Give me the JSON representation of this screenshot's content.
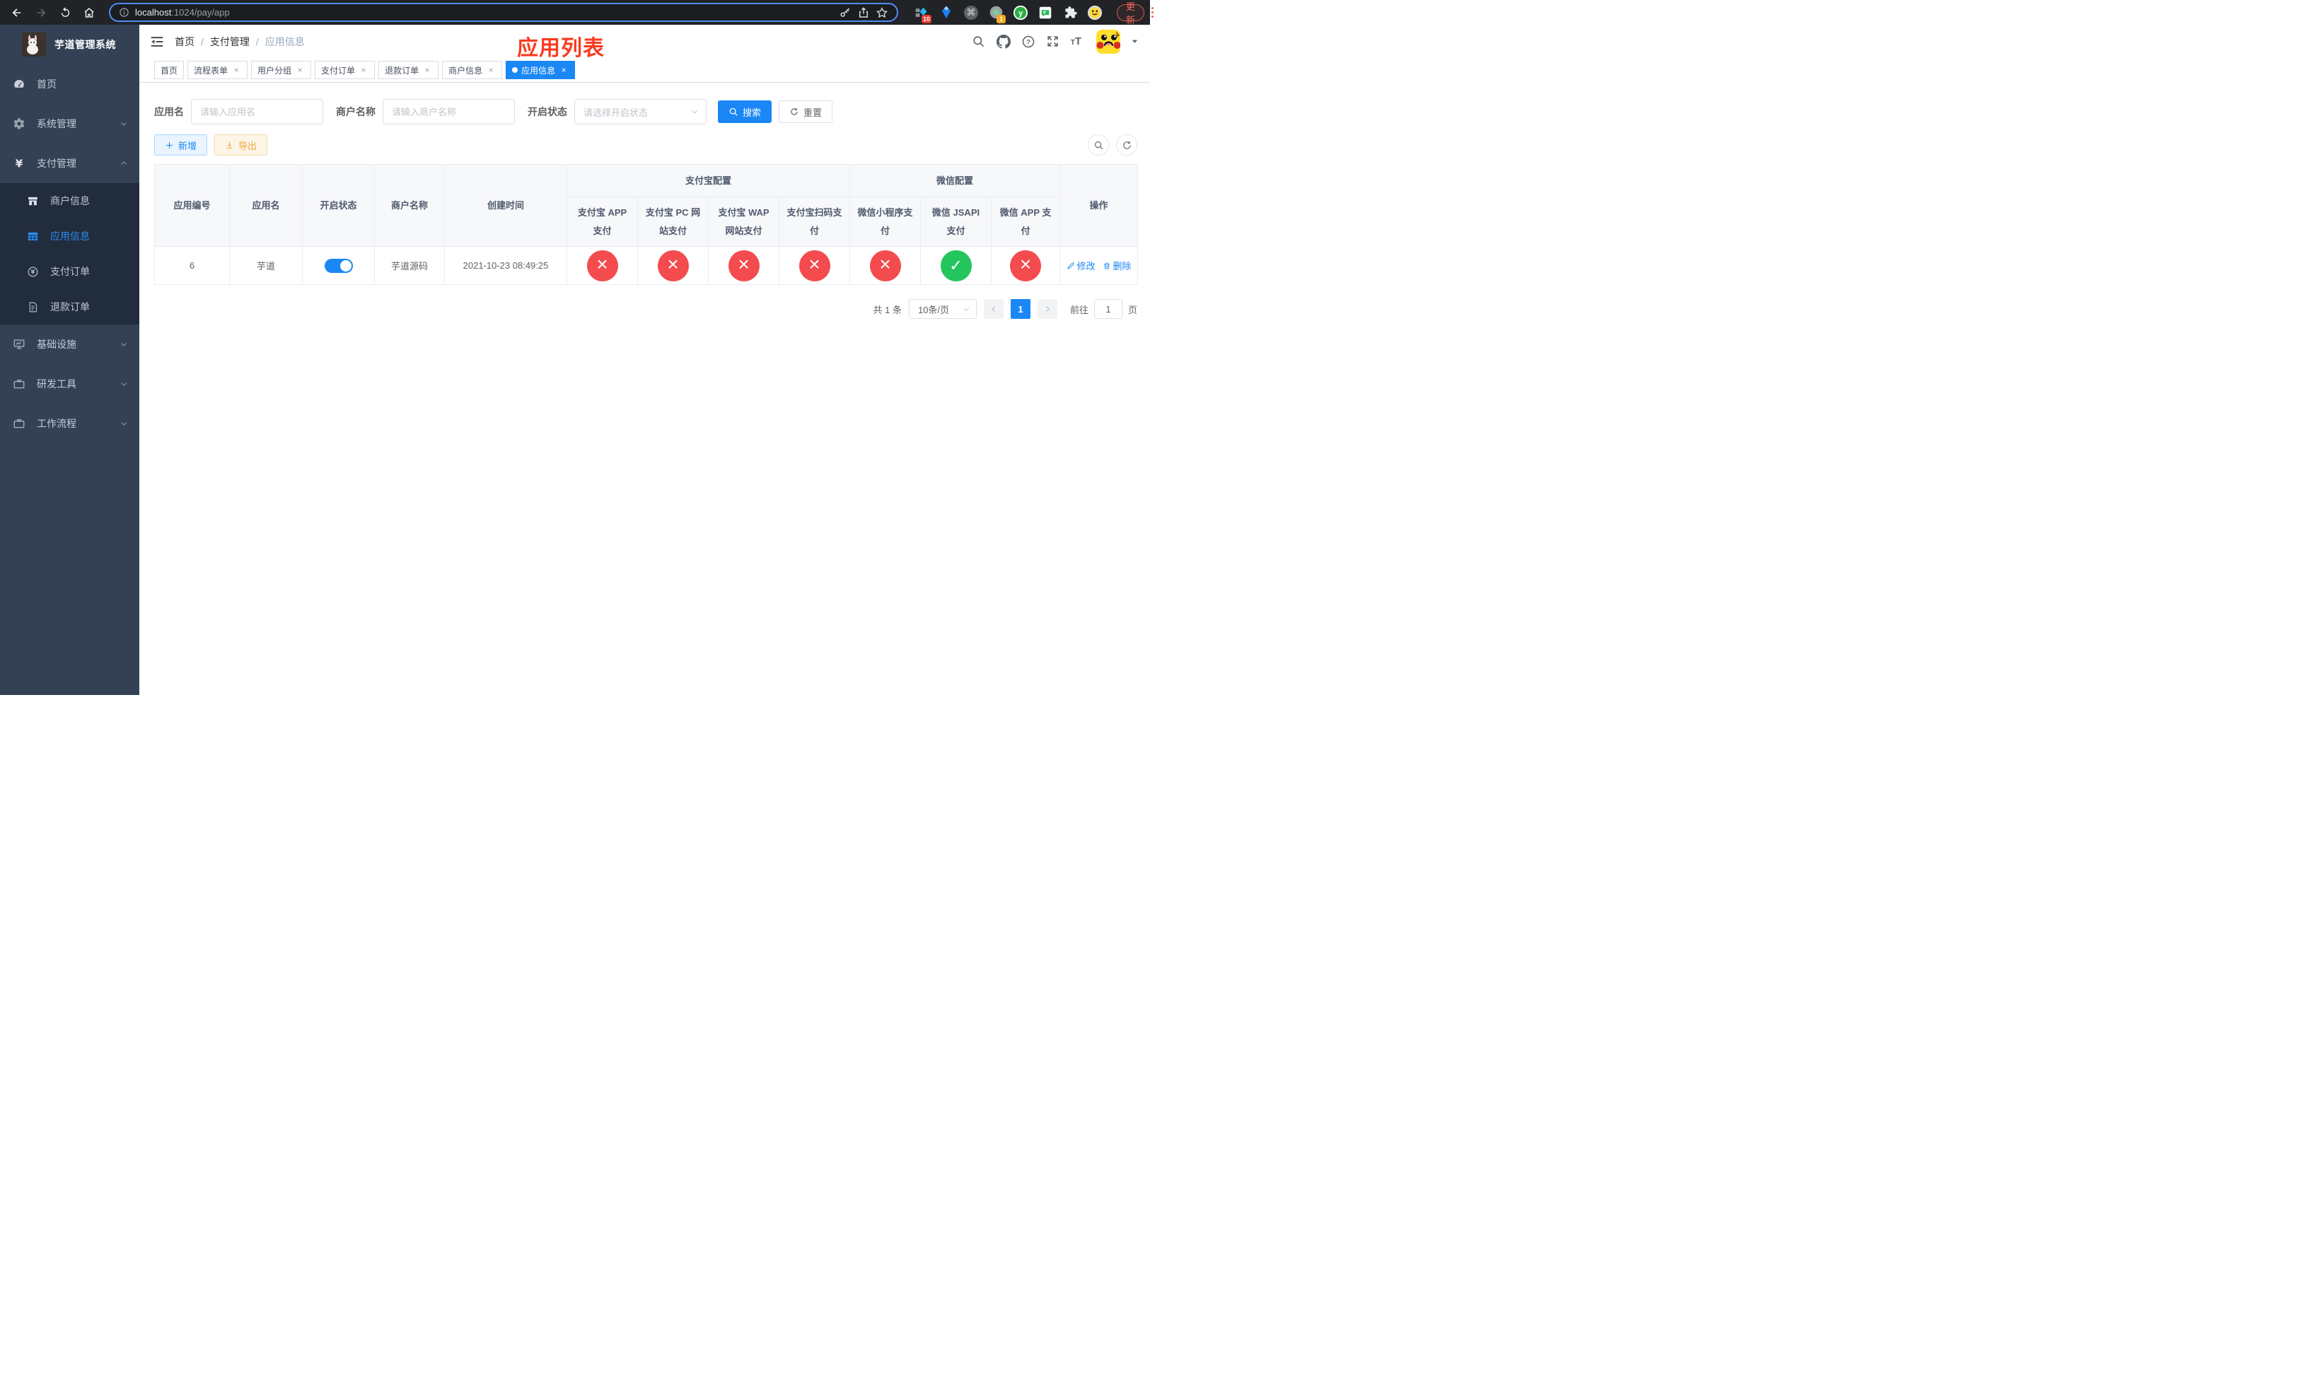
{
  "colors": {
    "accent": "#1b87f5",
    "danger": "#f44b4e",
    "success": "#23c55c",
    "annotation": "#f93b20",
    "sidebar_bg": "#344155",
    "submenu_bg": "#212c3c"
  },
  "icons": {
    "close": "×",
    "cmd": "⌘"
  },
  "browser": {
    "url_host": "localhost",
    "url_rest": ":1024/pay/app",
    "ext_badge_red": "10",
    "ext_badge_orange": "1",
    "update_label": "更新"
  },
  "sidebar": {
    "title": "芋道管理系统",
    "items": [
      {
        "label": "首页"
      },
      {
        "label": "系统管理"
      },
      {
        "label": "支付管理"
      },
      {
        "label": "商户信息"
      },
      {
        "label": "应用信息"
      },
      {
        "label": "支付订单"
      },
      {
        "label": "退款订单"
      },
      {
        "label": "基础设施"
      },
      {
        "label": "研发工具"
      },
      {
        "label": "工作流程"
      }
    ]
  },
  "header": {
    "separator": "/",
    "breadcrumb": [
      {
        "label": "首页"
      },
      {
        "label": "支付管理"
      },
      {
        "label": "应用信息"
      }
    ],
    "annotation": "应用列表"
  },
  "tabs": [
    {
      "label": "首页"
    },
    {
      "label": "流程表单"
    },
    {
      "label": "用户分组"
    },
    {
      "label": "支付订单"
    },
    {
      "label": "退款订单"
    },
    {
      "label": "商户信息"
    },
    {
      "label": "应用信息"
    }
  ],
  "filters": {
    "app_name": {
      "label": "应用名",
      "placeholder": "请输入应用名",
      "value": ""
    },
    "merchant_name": {
      "label": "商户名称",
      "placeholder": "请输入商户名称",
      "value": ""
    },
    "status": {
      "label": "开启状态",
      "placeholder": "请选择开启状态"
    },
    "search_label": "搜索",
    "reset_label": "重置"
  },
  "toolbar": {
    "add_label": "新增",
    "export_label": "导出"
  },
  "table": {
    "columns": {
      "app_id": "应用编号",
      "app_name": "应用名",
      "status": "开启状态",
      "merchant": "商户名称",
      "create_time": "创建时间",
      "alipay_group": "支付宝配置",
      "wechat_group": "微信配置",
      "actions": "操作",
      "pay_channels": [
        "支付宝 APP 支付",
        "支付宝 PC 网站支付",
        "支付宝 WAP 网站支付",
        "支付宝扫码支付",
        "微信小程序支付",
        "微信 JSAPI 支付",
        "微信 APP 支付"
      ]
    },
    "rows": [
      {
        "app_id": "6",
        "app_name": "芋道",
        "enabled": "true",
        "merchant": "芋道源码",
        "create_time": "2021-10-23 08:49:25",
        "channel_status": [
          "no",
          "no",
          "no",
          "no",
          "no",
          "yes",
          "no"
        ],
        "edit_label": "修改",
        "delete_label": "删除"
      }
    ]
  },
  "pagination": {
    "total_label": "共 1 条",
    "page_size": "10条/页",
    "current_page": "1",
    "goto_label": "前往",
    "goto_value": "1",
    "page_suffix": "页"
  }
}
